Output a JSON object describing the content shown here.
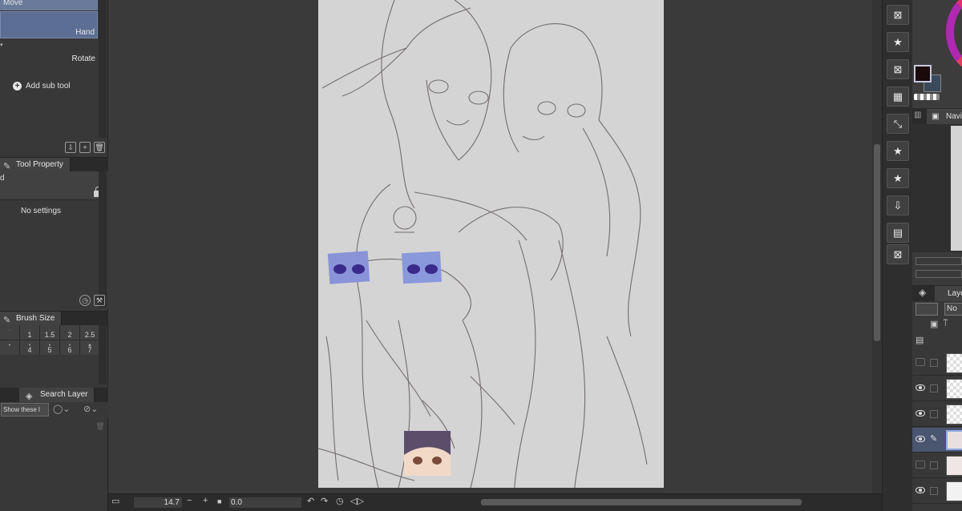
{
  "subtools": {
    "move": "Move",
    "hand": "Hand",
    "rotate": "Rotate",
    "add_subtool": "Add sub tool"
  },
  "tool_property": {
    "tab": "Tool Property",
    "tool_name_fragment": "d",
    "empty_message": "No settings"
  },
  "brush_size": {
    "tab": "Brush Size",
    "row1": [
      "",
      "1",
      "1.5",
      "2",
      "2.5"
    ],
    "row2": [
      "",
      "4",
      "5",
      "6",
      "7"
    ]
  },
  "search_layer": {
    "tab": "Search Layer",
    "filter_value": "Show these l"
  },
  "status": {
    "zoom": "14.7",
    "angle": "0.0"
  },
  "navigator": {
    "tab": "Navi"
  },
  "layers": {
    "tab": "Laye",
    "blend_mode": "No",
    "rows": [
      {
        "visible": false,
        "active": false
      },
      {
        "visible": true,
        "active": false
      },
      {
        "visible": true,
        "active": false
      },
      {
        "visible": true,
        "active": true
      },
      {
        "visible": false,
        "active": false
      },
      {
        "visible": true,
        "active": false
      }
    ]
  },
  "colors": {
    "main_color": "#1a0a0a",
    "sub_color": "#3a4a5a",
    "active_layer": "#4a5570"
  },
  "command_bar_icons": [
    "clear-icon",
    "star-icon",
    "clear-icon",
    "layer-fill-icon",
    "transform-icon",
    "star-icon",
    "star-icon",
    "export-icon",
    "stack-icon",
    "clear-icon"
  ]
}
